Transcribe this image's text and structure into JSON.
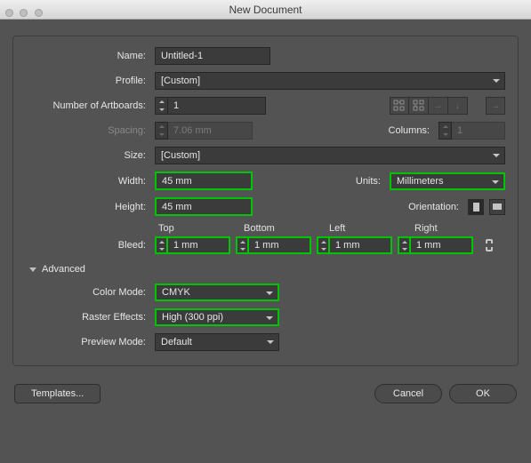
{
  "window": {
    "title": "New Document"
  },
  "labels": {
    "name": "Name:",
    "profile": "Profile:",
    "numArtboards": "Number of Artboards:",
    "spacing": "Spacing:",
    "columns": "Columns:",
    "size": "Size:",
    "width": "Width:",
    "units": "Units:",
    "height": "Height:",
    "orientation": "Orientation:",
    "bleed": "Bleed:",
    "advanced": "Advanced",
    "colorMode": "Color Mode:",
    "rasterEffects": "Raster Effects:",
    "previewMode": "Preview Mode:",
    "top": "Top",
    "bottom": "Bottom",
    "left": "Left",
    "right": "Right"
  },
  "values": {
    "name": "Untitled-1",
    "profile": "[Custom]",
    "artboards": "1",
    "spacing": "7.06 mm",
    "columns": "1",
    "size": "[Custom]",
    "width": "45 mm",
    "height": "45 mm",
    "units": "Millimeters",
    "bleedTop": "1 mm",
    "bleedBottom": "1 mm",
    "bleedLeft": "1 mm",
    "bleedRight": "1 mm",
    "colorMode": "CMYK",
    "rasterEffects": "High (300 ppi)",
    "previewMode": "Default"
  },
  "buttons": {
    "templates": "Templates...",
    "cancel": "Cancel",
    "ok": "OK"
  }
}
